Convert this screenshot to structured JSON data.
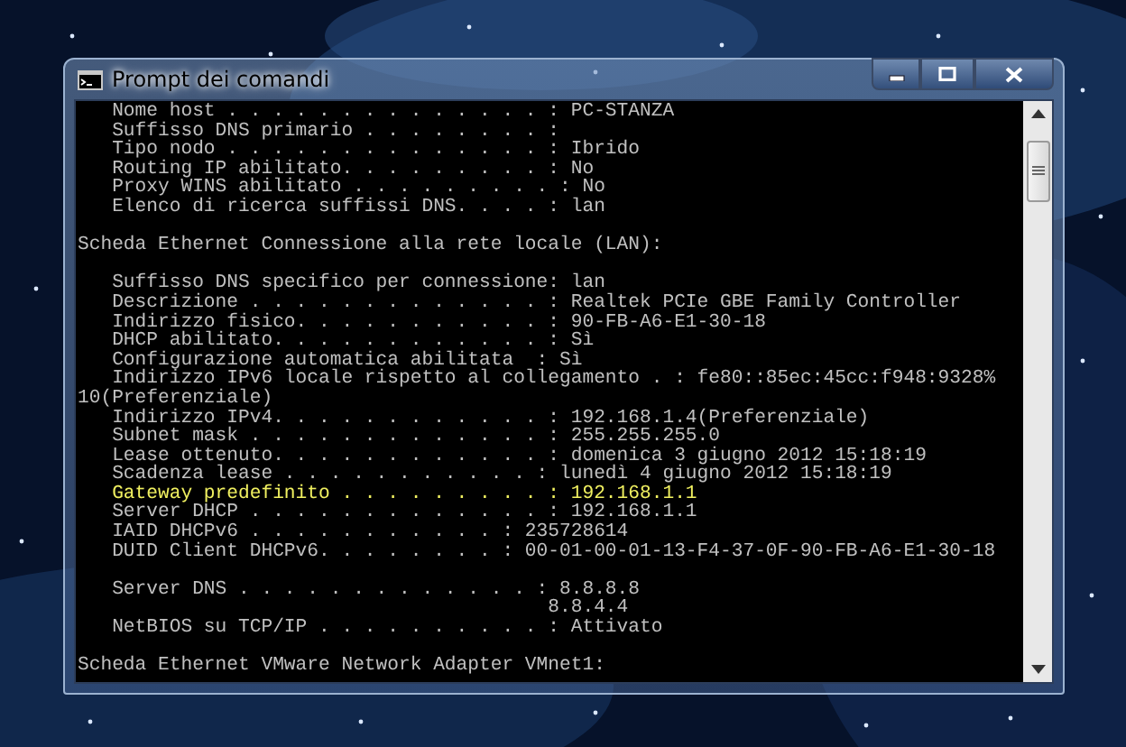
{
  "window": {
    "title": "Prompt dei comandi"
  },
  "console": {
    "lines": [
      {
        "kind": "entry",
        "text": "Nome host . . . . . . . . . . . . . . : PC-STANZA",
        "highlighted": false,
        "gap_before": false
      },
      {
        "kind": "entry",
        "text": "Suffisso DNS primario . . . . . . . . :",
        "highlighted": false,
        "gap_before": false
      },
      {
        "kind": "entry",
        "text": "Tipo nodo . . . . . . . . . . . . . . : Ibrido",
        "highlighted": false,
        "gap_before": false
      },
      {
        "kind": "entry",
        "text": "Routing IP abilitato. . . . . . . . . : No",
        "highlighted": false,
        "gap_before": false
      },
      {
        "kind": "entry",
        "text": "Proxy WINS abilitato . . . . . . . . . : No",
        "highlighted": false,
        "gap_before": false
      },
      {
        "kind": "entry",
        "text": "Elenco di ricerca suffissi DNS. . . . : lan",
        "highlighted": false,
        "gap_before": false
      },
      {
        "kind": "header",
        "text": "Scheda Ethernet Connessione alla rete locale (LAN):",
        "highlighted": false,
        "gap_before": true
      },
      {
        "kind": "entry",
        "text": "Suffisso DNS specifico per connessione: lan",
        "highlighted": false,
        "gap_before": true
      },
      {
        "kind": "entry",
        "text": "Descrizione . . . . . . . . . . . . . : Realtek PCIe GBE Family Controller",
        "highlighted": false,
        "gap_before": false
      },
      {
        "kind": "entry",
        "text": "Indirizzo fisico. . . . . . . . . . . : 90-FB-A6-E1-30-18",
        "highlighted": false,
        "gap_before": false
      },
      {
        "kind": "entry",
        "text": "DHCP abilitato. . . . . . . . . . . . : Sì",
        "highlighted": false,
        "gap_before": false
      },
      {
        "kind": "entry",
        "text": "Configurazione automatica abilitata  : Sì",
        "highlighted": false,
        "gap_before": false
      },
      {
        "kind": "entry",
        "text": "Indirizzo IPv6 locale rispetto al collegamento . : fe80::85ec:45cc:f948:9328%",
        "highlighted": false,
        "gap_before": false
      },
      {
        "kind": "wrap",
        "text": "10(Preferenziale)",
        "highlighted": false,
        "gap_before": false
      },
      {
        "kind": "entry",
        "text": "Indirizzo IPv4. . . . . . . . . . . . : 192.168.1.4(Preferenziale)",
        "highlighted": false,
        "gap_before": false
      },
      {
        "kind": "entry",
        "text": "Subnet mask . . . . . . . . . . . . . : 255.255.255.0",
        "highlighted": false,
        "gap_before": false
      },
      {
        "kind": "entry",
        "text": "Lease ottenuto. . . . . . . . . . . . : domenica 3 giugno 2012 15:18:19",
        "highlighted": false,
        "gap_before": false
      },
      {
        "kind": "entry",
        "text": "Scadenza lease . . . . . . . . . . . : lunedì 4 giugno 2012 15:18:19",
        "highlighted": false,
        "gap_before": false
      },
      {
        "kind": "entry",
        "text": "Gateway predefinito . . . . . . . . . : 192.168.1.1",
        "highlighted": true,
        "gap_before": false
      },
      {
        "kind": "entry",
        "text": "Server DHCP . . . . . . . . . . . . . : 192.168.1.1",
        "highlighted": false,
        "gap_before": false
      },
      {
        "kind": "entry",
        "text": "IAID DHCPv6 . . . . . . . . . . . : 235728614",
        "highlighted": false,
        "gap_before": false
      },
      {
        "kind": "entry",
        "text": "DUID Client DHCPv6. . . . . . . . : 00-01-00-01-13-F4-37-0F-90-FB-A6-E1-30-18",
        "highlighted": false,
        "gap_before": false
      },
      {
        "kind": "entry",
        "text": "Server DNS . . . . . . . . . . . . . : 8.8.8.8",
        "highlighted": false,
        "gap_before": true
      },
      {
        "kind": "value",
        "text": "8.8.4.4",
        "highlighted": false,
        "gap_before": false
      },
      {
        "kind": "entry",
        "text": "NetBIOS su TCP/IP . . . . . . . . . . : Attivato",
        "highlighted": false,
        "gap_before": false
      },
      {
        "kind": "header",
        "text": "Scheda Ethernet VMware Network Adapter VMnet1:",
        "highlighted": false,
        "gap_before": true
      }
    ]
  }
}
